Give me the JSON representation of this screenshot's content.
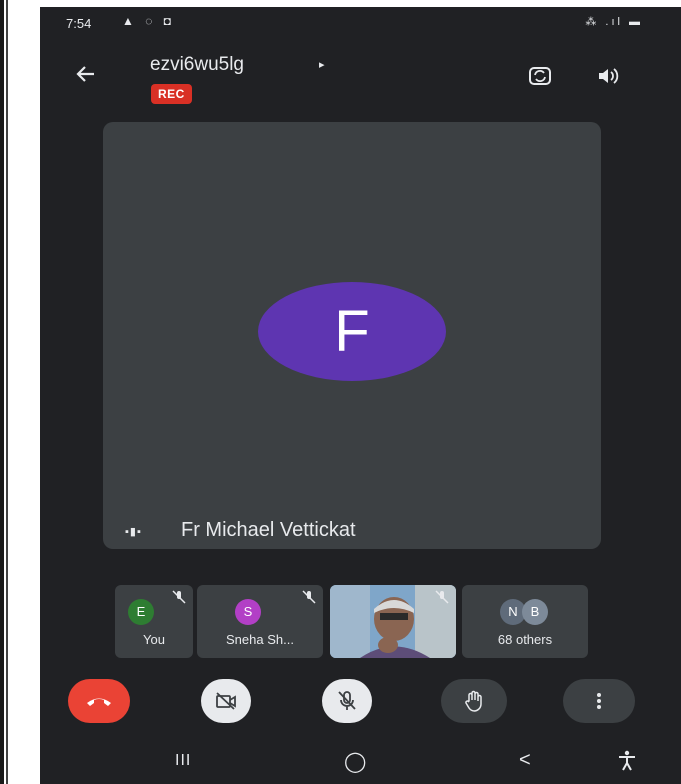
{
  "status_bar": {
    "time": "7:54",
    "left_icons": "▲ ◌ ◘",
    "right_icons": "⁂ .ıl ▬"
  },
  "header": {
    "meeting_code": "ezvi6wu5lg",
    "caret": "▸",
    "rec_badge": "REC"
  },
  "main_speaker": {
    "initial": "F",
    "name": "Fr Michael Vettickat",
    "avatar_color": "#5e35b1"
  },
  "participants": [
    {
      "initial": "E",
      "label": "You",
      "color": "#2e7d32"
    },
    {
      "initial": "S",
      "label": "Sneha Sh...",
      "color": "#b23fc6"
    },
    {
      "label": "",
      "has_video": true
    },
    {
      "initials": [
        "N",
        "B"
      ],
      "label": "68 others",
      "colors": [
        "#5f6b7a",
        "#7d8a99"
      ]
    }
  ],
  "controls": {
    "end_call_color": "#ea4335",
    "more_glyph": "⋮"
  },
  "nav": {
    "recents": "III",
    "home": "◯",
    "back": "<",
    "accessibility": "⚲"
  }
}
